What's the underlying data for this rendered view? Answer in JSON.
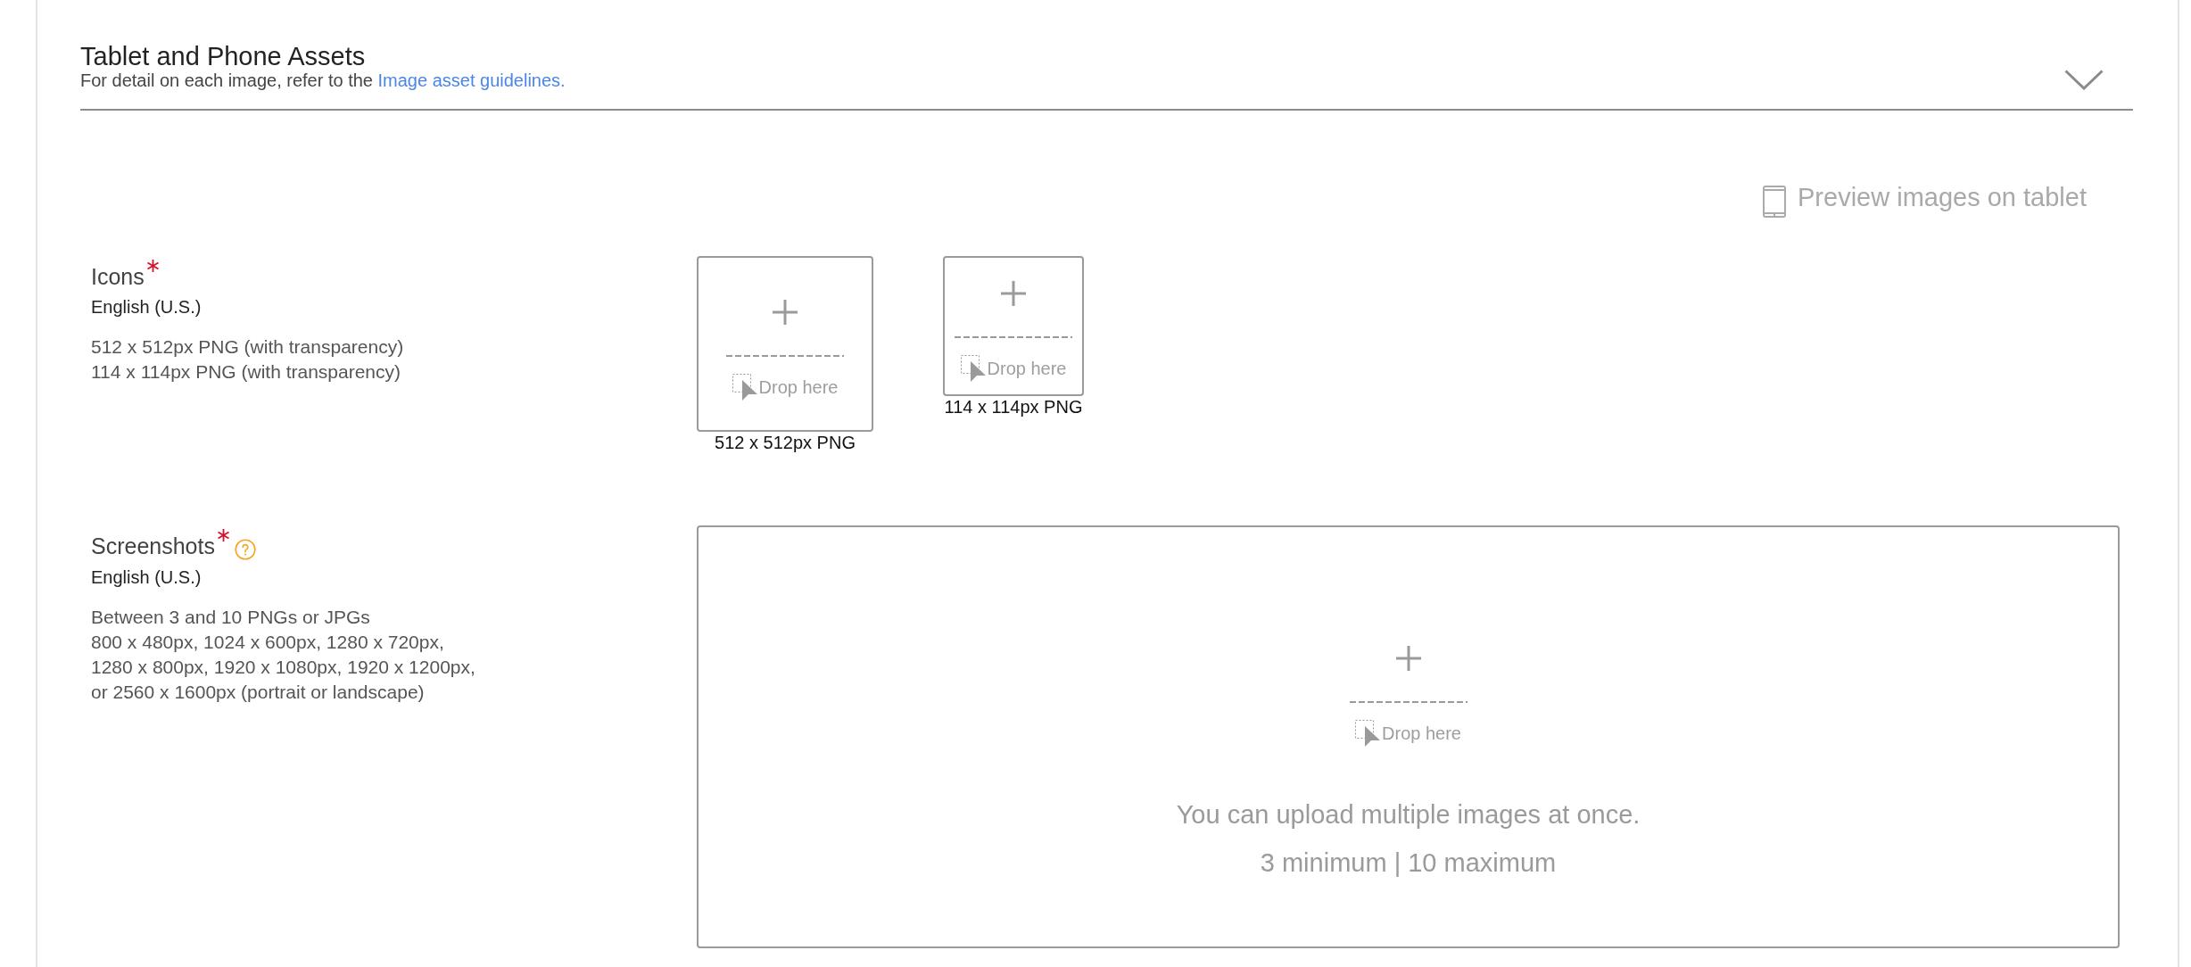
{
  "section": {
    "title": "Tablet and Phone Assets",
    "subtitle": "For detail on each image, refer to the",
    "link": "Image asset guidelines."
  },
  "preview_button": {
    "label": "Preview images on tablet"
  },
  "fields": [
    {
      "kind": "icon_slots",
      "label": "Icons",
      "required": true,
      "help": false,
      "language": "English (U.S.)",
      "requirements": [
        "512 x 512px PNG (with transparency)",
        "114 x 114px PNG (with transparency)"
      ],
      "slots": [
        {
          "kind": "large",
          "drop_label": "Drop here",
          "caption": "512 x 512px PNG"
        },
        {
          "kind": "small",
          "drop_label": "Drop here",
          "caption": "114 x 114px PNG"
        }
      ]
    },
    {
      "kind": "gallery",
      "label": "Screenshots",
      "required": true,
      "help": true,
      "language": "English (U.S.)",
      "requirements": [
        "Between 3 and 10 PNGs or JPGs",
        "800 x 480px, 1024 x 600px, 1280 x 720px,",
        "1280 x 800px, 1920 x 1080px, 1920 x 1200px,",
        "or 2560 x 1600px (portrait or landscape)"
      ],
      "drop_label": "Drop here",
      "notes": [
        "You can upload multiple images at once.",
        "3 minimum | 10 maximum"
      ]
    }
  ]
}
